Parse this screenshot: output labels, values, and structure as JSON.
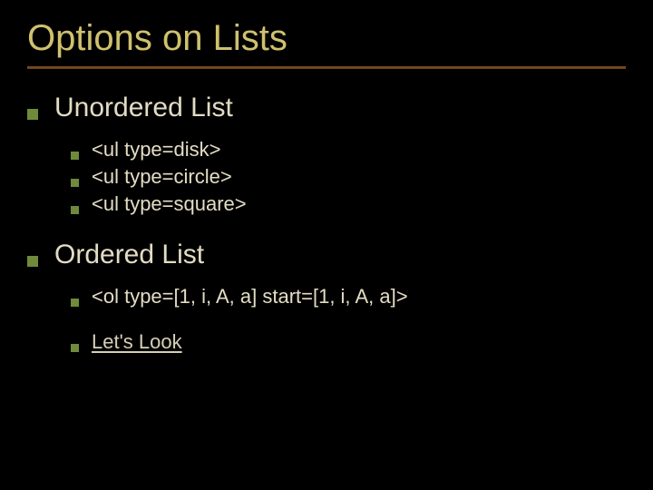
{
  "title": "Options on Lists",
  "sections": [
    {
      "heading": "Unordered List",
      "items": [
        {
          "label": "<ul type=disk>",
          "link": false
        },
        {
          "label": "<ul type=circle>",
          "link": false
        },
        {
          "label": "<ul type=square>",
          "link": false
        }
      ]
    },
    {
      "heading": "Ordered List",
      "items": [
        {
          "label": "<ol type=[1, i, A, a] start=[1, i, A, a]>",
          "link": false
        },
        {
          "label": "Let's Look",
          "link": true
        }
      ]
    }
  ]
}
